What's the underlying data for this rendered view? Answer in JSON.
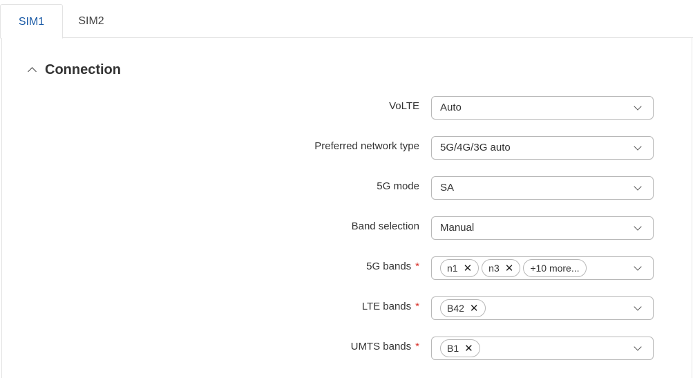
{
  "tabs": [
    {
      "label": "SIM1",
      "active": true
    },
    {
      "label": "SIM2",
      "active": false
    }
  ],
  "section": {
    "title": "Connection",
    "expanded": true
  },
  "fields": {
    "volte": {
      "label": "VoLTE",
      "value": "Auto"
    },
    "network_type": {
      "label": "Preferred network type",
      "value": "5G/4G/3G auto"
    },
    "mode_5g": {
      "label": "5G mode",
      "value": "SA"
    },
    "band_selection": {
      "label": "Band selection",
      "value": "Manual"
    },
    "bands_5g": {
      "label": "5G bands",
      "required": "*",
      "chips": [
        "n1",
        "n3"
      ],
      "more": "+10 more..."
    },
    "bands_lte": {
      "label": "LTE bands",
      "required": "*",
      "chips": [
        "B42"
      ]
    },
    "bands_umts": {
      "label": "UMTS bands",
      "required": "*",
      "chips": [
        "B1"
      ]
    }
  },
  "icons": {
    "remove": "✕",
    "collapse": "chevron-up-icon",
    "dropdown": "chevron-down-icon"
  },
  "colors": {
    "accent": "#1a5aa6",
    "required": "#d9332b",
    "border": "#b8b8b8"
  }
}
